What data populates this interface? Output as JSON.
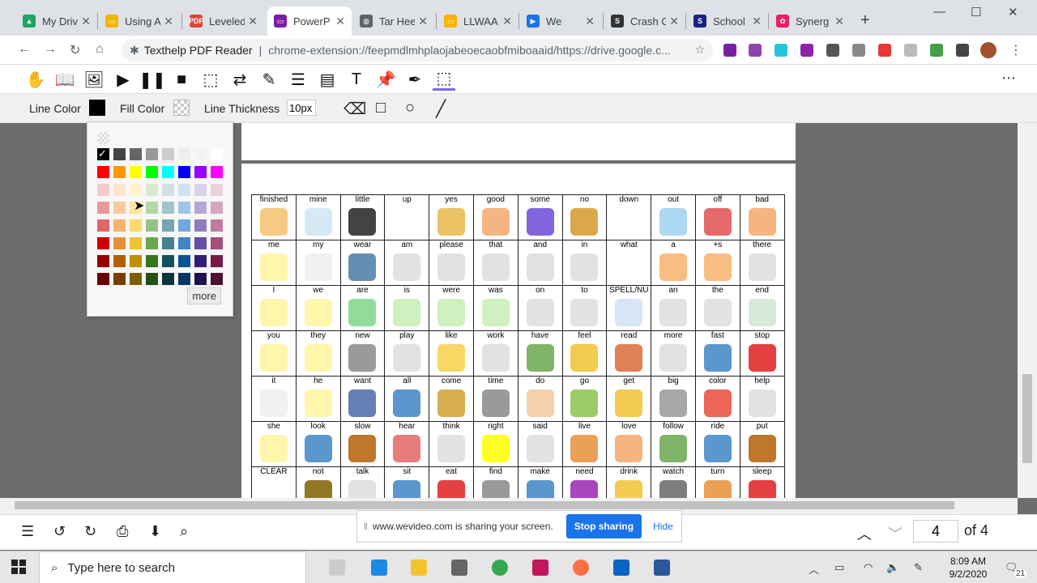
{
  "tabs": [
    {
      "title": "My Driv",
      "color": "#1fa463",
      "glyph": "▲"
    },
    {
      "title": "Using A",
      "color": "#f4b400",
      "glyph": "▭"
    },
    {
      "title": "Leveled",
      "color": "#db4437",
      "glyph": "PDF"
    },
    {
      "title": "PowerP",
      "color": "#7b1fa2",
      "glyph": "▭"
    },
    {
      "title": "Tar Hee",
      "color": "#5f6368",
      "glyph": "◍"
    },
    {
      "title": "LLWAA",
      "color": "#f4b400",
      "glyph": "▭"
    },
    {
      "title": "We",
      "color": "#1a73e8",
      "glyph": "▶"
    },
    {
      "title": "Crash C",
      "color": "#333333",
      "glyph": "S"
    },
    {
      "title": "School",
      "color": "#1a237e",
      "glyph": "S"
    },
    {
      "title": "Synerg",
      "color": "#e91e63",
      "glyph": "✿"
    }
  ],
  "address": {
    "site": "Texthelp PDF Reader",
    "url": "chrome-extension://feepmdlmhplaojabeoecaobfmiboaaid/https://drive.google.c..."
  },
  "options": {
    "line_color_label": "Line Color",
    "fill_color_label": "Fill Color",
    "line_thickness_label": "Line Thickness",
    "line_thickness_value": "10px",
    "line_color": "#000000"
  },
  "picker": {
    "more_label": "more",
    "palette": [
      [
        "#000000",
        "#444444",
        "#666666",
        "#999999",
        "#cccccc",
        "#eeeeee",
        "#f3f3f3",
        "#ffffff"
      ],
      [
        "#ff0000",
        "#ff9900",
        "#ffff00",
        "#00ff00",
        "#00ffff",
        "#0000ff",
        "#9900ff",
        "#ff00ff"
      ],
      [
        "#f4cccc",
        "#fce5cd",
        "#fff2cc",
        "#d9ead3",
        "#d0e0e3",
        "#cfe2f3",
        "#d9d2e9",
        "#ead1dc"
      ],
      [
        "#ea9999",
        "#f9cb9c",
        "#ffe599",
        "#b6d7a8",
        "#a2c4c9",
        "#9fc5e8",
        "#b4a7d6",
        "#d5a6bd"
      ],
      [
        "#e06666",
        "#f6b26b",
        "#ffd966",
        "#93c47d",
        "#76a5af",
        "#6fa8dc",
        "#8e7cc3",
        "#c27ba0"
      ],
      [
        "#cc0000",
        "#e69138",
        "#f1c232",
        "#6aa84f",
        "#45818e",
        "#3d85c6",
        "#674ea7",
        "#a64d79"
      ],
      [
        "#990000",
        "#b45f06",
        "#bf9000",
        "#38761d",
        "#134f5c",
        "#0b5394",
        "#351c75",
        "#741b47"
      ],
      [
        "#660000",
        "#783f04",
        "#7f6000",
        "#274e13",
        "#0c343d",
        "#073763",
        "#20124d",
        "#4c1130"
      ]
    ]
  },
  "board": {
    "rows": [
      [
        {
          "w": "finished",
          "c": "#f5c16c"
        },
        {
          "w": "mine",
          "c": "#cfe6f5"
        },
        {
          "w": "little",
          "c": "#222222"
        },
        {
          "w": "up",
          "c": "#ffffff"
        },
        {
          "w": "yes",
          "c": "#e8b84a"
        },
        {
          "w": "good",
          "c": "#f3a86b"
        },
        {
          "w": "some",
          "c": "#6a4ad8"
        },
        {
          "w": "no",
          "c": "#d59a2c"
        },
        {
          "w": "down",
          "c": "#ffffff"
        },
        {
          "w": "out",
          "c": "#9fd0f0"
        },
        {
          "w": "off",
          "c": "#e05050"
        },
        {
          "w": "bad",
          "c": "#f3a86b"
        }
      ],
      [
        {
          "w": "me",
          "c": "#fff59d"
        },
        {
          "w": "my",
          "c": "#eeeeee"
        },
        {
          "w": "wear",
          "c": "#4a7aa8"
        },
        {
          "w": "am",
          "c": "#dddddd"
        },
        {
          "w": "please",
          "c": "#dddddd"
        },
        {
          "w": "that",
          "c": "#dddddd"
        },
        {
          "w": "and",
          "c": "#dddddd"
        },
        {
          "w": "in",
          "c": "#dddddd"
        },
        {
          "w": "what",
          "c": "#ffffff"
        },
        {
          "w": "a",
          "c": "#f7b26b"
        },
        {
          "w": "+s",
          "c": "#f7b26b"
        },
        {
          "w": "there",
          "c": "#dddddd"
        }
      ],
      [
        {
          "w": "I",
          "c": "#fff59d"
        },
        {
          "w": "we",
          "c": "#fff59d"
        },
        {
          "w": "are",
          "c": "#7fd68a"
        },
        {
          "w": "is",
          "c": "#c5eeb4"
        },
        {
          "w": "were",
          "c": "#c5eeb4"
        },
        {
          "w": "was",
          "c": "#c5eeb4"
        },
        {
          "w": "on",
          "c": "#dddddd"
        },
        {
          "w": "to",
          "c": "#dddddd"
        },
        {
          "w": "SPELL/NU",
          "c": "#cfe2f3"
        },
        {
          "w": "an",
          "c": "#dddddd"
        },
        {
          "w": "the",
          "c": "#dddddd"
        },
        {
          "w": "end",
          "c": "#cfe6d0"
        }
      ],
      [
        {
          "w": "you",
          "c": "#fff59d"
        },
        {
          "w": "they",
          "c": "#fff59d"
        },
        {
          "w": "new",
          "c": "#888888"
        },
        {
          "w": "play",
          "c": "#dddddd"
        },
        {
          "w": "like",
          "c": "#f7d04a"
        },
        {
          "w": "work",
          "c": "#dddddd"
        },
        {
          "w": "have",
          "c": "#6aa84f"
        },
        {
          "w": "feel",
          "c": "#f1c232"
        },
        {
          "w": "read",
          "c": "#d96b3b"
        },
        {
          "w": "more",
          "c": "#dddddd"
        },
        {
          "w": "fast",
          "c": "#3d85c6"
        },
        {
          "w": "stop",
          "c": "#e02020"
        }
      ],
      [
        {
          "w": "it",
          "c": "#eeeeee"
        },
        {
          "w": "he",
          "c": "#fff59d"
        },
        {
          "w": "want",
          "c": "#4a6aa8"
        },
        {
          "w": "all",
          "c": "#3d85c6"
        },
        {
          "w": "come",
          "c": "#d0a030"
        },
        {
          "w": "time",
          "c": "#888888"
        },
        {
          "w": "do",
          "c": "#f3c8a0"
        },
        {
          "w": "go",
          "c": "#8bc34a"
        },
        {
          "w": "get",
          "c": "#f1c232"
        },
        {
          "w": "big",
          "c": "#999999"
        },
        {
          "w": "color",
          "c": "#e94a3a"
        },
        {
          "w": "help",
          "c": "#dddddd"
        }
      ],
      [
        {
          "w": "she",
          "c": "#fff59d"
        },
        {
          "w": "look",
          "c": "#3d85c6"
        },
        {
          "w": "slow",
          "c": "#b45f06"
        },
        {
          "w": "hear",
          "c": "#e06666"
        },
        {
          "w": "think",
          "c": "#dddddd"
        },
        {
          "w": "right",
          "c": "#ffff00"
        },
        {
          "w": "said",
          "c": "#dddddd"
        },
        {
          "w": "live",
          "c": "#e69138"
        },
        {
          "w": "love",
          "c": "#f3a86b"
        },
        {
          "w": "follow",
          "c": "#6aa84f"
        },
        {
          "w": "ride",
          "c": "#3d85c6"
        },
        {
          "w": "put",
          "c": "#b45f06"
        }
      ],
      [
        {
          "w": "CLEAR",
          "c": "#ffffff"
        },
        {
          "w": "not",
          "c": "#7f6000"
        },
        {
          "w": "talk",
          "c": "#dddddd"
        },
        {
          "w": "sit",
          "c": "#3d85c6"
        },
        {
          "w": "eat",
          "c": "#e02020"
        },
        {
          "w": "find",
          "c": "#888888"
        },
        {
          "w": "make",
          "c": "#3d85c6"
        },
        {
          "w": "need",
          "c": "#9c27b0"
        },
        {
          "w": "drink",
          "c": "#f1c232"
        },
        {
          "w": "watch",
          "c": "#666666"
        },
        {
          "w": "turn",
          "c": "#e69138"
        },
        {
          "w": "sleep",
          "c": "#e02020"
        }
      ]
    ]
  },
  "bottom": {
    "page_current": "4",
    "page_total": "of 4"
  },
  "share": {
    "text": "www.wevideo.com is sharing your screen.",
    "stop": "Stop sharing",
    "hide": "Hide"
  },
  "taskbar": {
    "search_placeholder": "Type here to search",
    "time": "8:09 AM",
    "date": "9/2/2020",
    "notif_count": "21"
  }
}
